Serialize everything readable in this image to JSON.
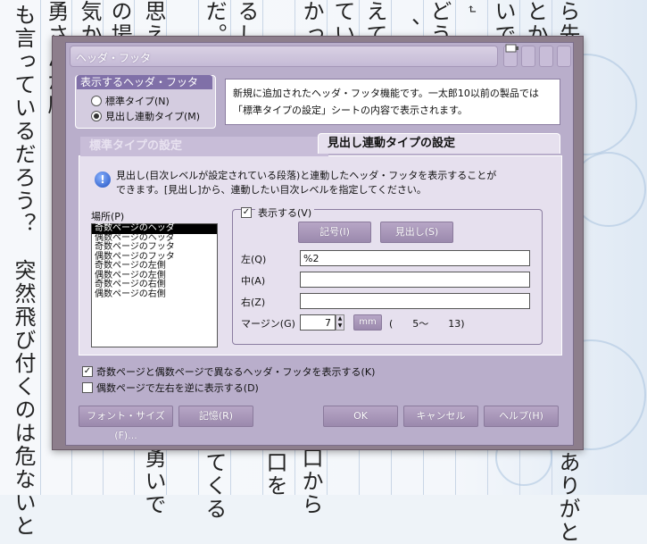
{
  "background": {
    "columns": [
      {
        "text": "も言っているだろう？　突然飛び付くのは危ないと"
      },
      {
        "text": "勇さんが座"
      },
      {
        "text": "気かに"
      },
      {
        "text": "の場"
      },
      {
        "text": "思え"
      },
      {
        "text": "だ。"
      },
      {
        "text": "るし"
      },
      {
        "text": "かっ"
      },
      {
        "text": "てい"
      },
      {
        "text": "えて"
      },
      {
        "text": "、差"
      },
      {
        "text": "どう"
      },
      {
        "text": "↵"
      },
      {
        "text": "いで"
      },
      {
        "text": "とか"
      },
      {
        "text": "ら先"
      },
      {
        "text": "勇いで"
      },
      {
        "text": "てくる"
      },
      {
        "text": "口を"
      },
      {
        "text": "口から"
      },
      {
        "text": "ありがと"
      }
    ]
  },
  "dialog": {
    "title": "ヘッダ・フッタ",
    "group_title": "表示するヘッダ・フッタ",
    "radio_standard": "標準タイプ(N)",
    "radio_heading": "見出し連動タイプ(M)",
    "info_line1": "新規に追加されたヘッダ・フッタ機能です。一太郎10以前の製品では",
    "info_line2": "「標準タイプの設定」シートの内容で表示されます。",
    "tab_standard": "標準タイプの設定",
    "tab_heading": "見出し連動タイプの設定",
    "desc_line1": "見出し(目次レベルが設定されている段落)と連動したヘッダ・フッタを表示することが",
    "desc_line2": "できます。[見出し]から、連動したい目次レベルを指定してください。",
    "location_label": "場所(P)",
    "locations": [
      "奇数ページのヘッダ",
      "偶数ページのヘッダ",
      "奇数ページのフッタ",
      "偶数ページのフッタ",
      "奇数ページの左側",
      "偶数ページの左側",
      "奇数ページの右側",
      "偶数ページの右側"
    ],
    "show_label": "表示する(V)",
    "btn_symbol": "記号(I)",
    "btn_heading": "見出し(S)",
    "left_label": "左(Q)",
    "left_value": "%2",
    "center_label": "中(A)",
    "center_value": "",
    "right_label": "右(Z)",
    "right_value": "",
    "margin_label": "マージン(G)",
    "margin_value": "7",
    "margin_unit": "mm",
    "margin_range": "(　　5～　　13)",
    "check_odd_even": "奇数ページと偶数ページで異なるヘッダ・フッタを表示する(K)",
    "check_swap": "偶数ページで左右を逆に表示する(D)",
    "btn_font": "フォント・サイズ(F)...",
    "btn_memory": "記憶(R)",
    "btn_ok": "OK",
    "btn_cancel": "キャンセル",
    "btn_help": "ヘルプ(H)"
  }
}
